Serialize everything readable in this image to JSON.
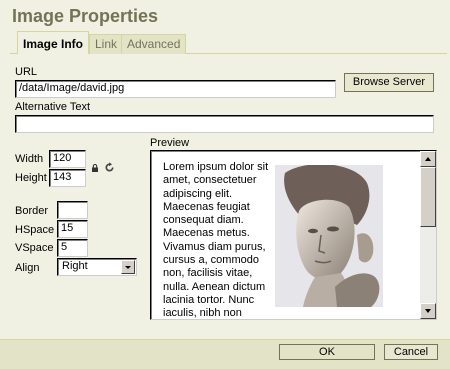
{
  "dialog": {
    "title": "Image Properties"
  },
  "tabs": [
    {
      "label": "Image Info",
      "active": true
    },
    {
      "label": "Link",
      "active": false
    },
    {
      "label": "Advanced",
      "active": false
    }
  ],
  "url": {
    "label": "URL",
    "value": "/data/Image/david.jpg"
  },
  "browse_server": {
    "label": "Browse Server"
  },
  "alt_text": {
    "label": "Alternative Text",
    "value": ""
  },
  "width": {
    "label": "Width",
    "value": "120"
  },
  "height": {
    "label": "Height",
    "value": "143"
  },
  "border": {
    "label": "Border",
    "value": ""
  },
  "hspace": {
    "label": "HSpace",
    "value": "15"
  },
  "vspace": {
    "label": "VSpace",
    "value": "5"
  },
  "align": {
    "label": "Align",
    "value": "Right"
  },
  "preview": {
    "label": "Preview",
    "text": "Lorem ipsum dolor sit amet, consectetuer adipiscing elit. Maecenas feugiat consequat diam. Maecenas metus. Vivamus diam purus, cursus a, commodo non, facilisis vitae, nulla. Aenean dictum lacinia tortor. Nunc iaculis, nibh non"
  },
  "footer": {
    "ok_label": "OK",
    "cancel_label": "Cancel"
  },
  "colors": {
    "background": "#f1f1e3",
    "footer": "#e3e3c7",
    "title": "#737357",
    "border": "#d5d59d"
  }
}
